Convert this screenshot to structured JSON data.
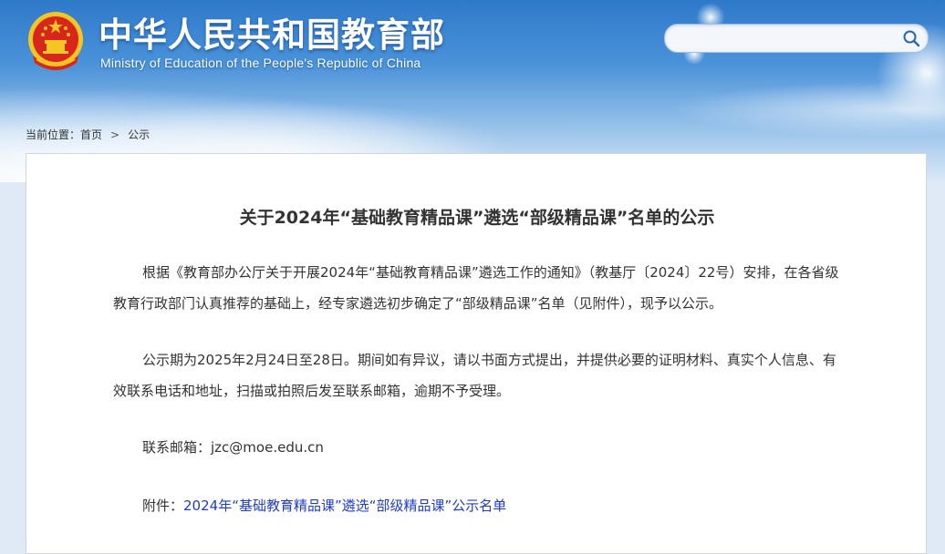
{
  "header": {
    "title": "中华人民共和国教育部",
    "subtitle": "Ministry of Education of the People's Republic of China",
    "search": {
      "placeholder": "",
      "value": ""
    }
  },
  "breadcrumb": {
    "label": "当前位置：",
    "items": [
      "首页",
      "公示"
    ],
    "separator": ">"
  },
  "article": {
    "title": "关于2024年“基础教育精品课”遴选“部级精品课”名单的公示",
    "paragraph1": "根据《教育部办公厅关于开展2024年“基础教育精品课”遴选工作的通知》（教基厅〔2024〕22号）安排，在各省级教育行政部门认真推荐的基础上，经专家遴选初步确定了“部级精品课”名单（见附件），现予以公示。",
    "paragraph2": "公示期为2025年2月24日至28日。期间如有异议，请以书面方式提出，并提供必要的证明材料、真实个人信息、有效联系电话和地址，扫描或拍照后发至联系邮箱，逾期不予受理。",
    "email_label": "联系邮箱：",
    "email": "jzc@moe.edu.cn",
    "attachment_label": "附件：",
    "attachment_link": "2024年“基础教育精品课”遴选“部级精品课”公示名单"
  },
  "colors": {
    "header_blue": "#2f79c9",
    "emblem_red": "#d8261c",
    "emblem_gold": "#f3c623",
    "link_blue": "#1d3bd1",
    "text": "#333333"
  },
  "icons": {
    "emblem": "national-emblem-icon",
    "search": "search-icon"
  }
}
